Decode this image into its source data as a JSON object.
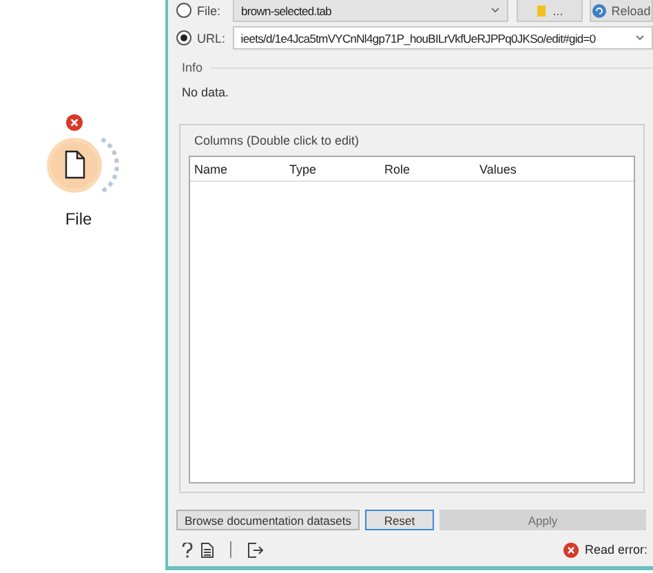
{
  "node": {
    "label": "File",
    "error": true
  },
  "source": {
    "file": {
      "label": "File:",
      "value": "brown-selected.tab",
      "selected": false
    },
    "url": {
      "label": "URL:",
      "value": "ieets/d/1e4Jca5tmVYCnNl4gp71P_houBILrVkfUeRJPPq0JKSo/edit#gid=0",
      "selected": true
    },
    "browse_button": "...",
    "reload_button": "Reload"
  },
  "info": {
    "title": "Info",
    "text": "No data."
  },
  "columns": {
    "title": "Columns (Double click to edit)",
    "headers": [
      "Name",
      "Type",
      "Role",
      "Values"
    ]
  },
  "buttons": [
    {
      "label": "Browse documentation datasets",
      "disabled": false,
      "focused": false
    },
    {
      "label": "Reset",
      "disabled": false,
      "focused": true
    },
    {
      "label": "Apply",
      "disabled": true,
      "focused": false
    }
  ],
  "status": {
    "message": "Read error:",
    "error": true
  }
}
